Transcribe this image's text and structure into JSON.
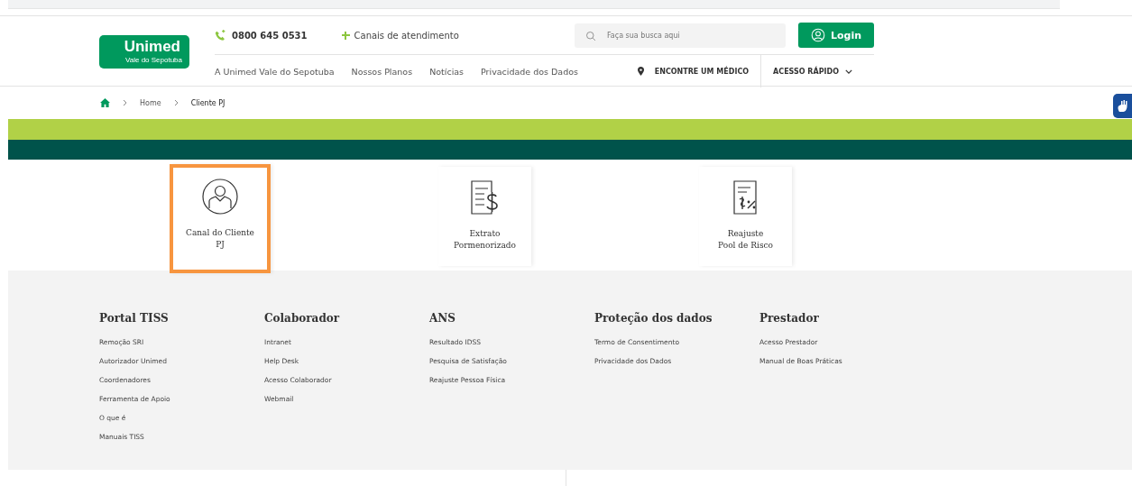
{
  "header": {
    "logo": {
      "name": "Unimed",
      "subtitle": "Vale do Sepotuba"
    },
    "phone": "0800 645 0531",
    "channels_link": "Canais de atendimento",
    "search": {
      "placeholder": "Faça sua busca aqui"
    },
    "login_button": "Login",
    "nav": [
      "A Unimed Vale do Sepotuba",
      "Nossos Planos",
      "Notícias",
      "Privacidade dos Dados"
    ],
    "find_doctor": "ENCONTRE UM MÉDICO",
    "quick_access": "ACESSO RÁPIDO"
  },
  "breadcrumb": [
    "Home",
    "Cliente PJ"
  ],
  "cards": [
    {
      "kind": "person",
      "lines": [
        "Canal do Cliente",
        "PJ"
      ],
      "selected": true
    },
    {
      "kind": "statement",
      "lines": [
        "Extrato",
        "Pormenorizado"
      ],
      "selected": false
    },
    {
      "kind": "adjustment",
      "lines": [
        "Reajuste",
        "Pool de Risco"
      ],
      "selected": false
    }
  ],
  "footer": [
    {
      "title": "Portal TISS",
      "links": [
        "Remoção SRI",
        "Autorizador Unimed",
        "Coordenadores",
        "Ferramenta de Apoio",
        "O que é",
        "Manuais TISS"
      ]
    },
    {
      "title": "Colaborador",
      "links": [
        "Intranet",
        "Help Desk",
        "Acesso Colaborador",
        "Webmail"
      ]
    },
    {
      "title": "ANS",
      "links": [
        "Resultado IDSS",
        "Pesquisa de Satisfação",
        "Reajuste Pessoa Física"
      ]
    },
    {
      "title": "Proteção dos dados",
      "links": [
        "Termo de Consentimento",
        "Privacidade dos Dados"
      ]
    },
    {
      "title": "Prestador",
      "links": [
        "Acesso Prestador",
        "Manual de Boas Práticas"
      ]
    }
  ]
}
